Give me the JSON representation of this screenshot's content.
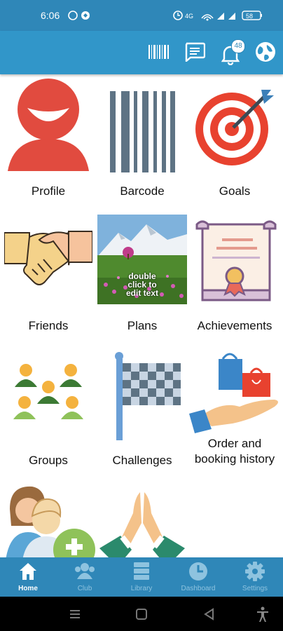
{
  "status": {
    "time": "6:06",
    "battery": "58"
  },
  "appbar": {
    "notification_count": "48"
  },
  "tiles": [
    {
      "label": "Profile"
    },
    {
      "label": "Barcode"
    },
    {
      "label": "Goals"
    },
    {
      "label": "Friends"
    },
    {
      "label": "Plans",
      "overlay": "double\nclick to\nedit text"
    },
    {
      "label": "Achievements"
    },
    {
      "label": "Groups"
    },
    {
      "label": "Challenges"
    },
    {
      "label": "Order and booking history"
    }
  ],
  "bottom_nav": [
    {
      "label": "Home",
      "icon": "home-icon"
    },
    {
      "label": "Club",
      "icon": "club-icon"
    },
    {
      "label": "Library",
      "icon": "library-icon"
    },
    {
      "label": "Dashboard",
      "icon": "dashboard-icon"
    },
    {
      "label": "Settings",
      "icon": "settings-icon"
    }
  ],
  "colors": {
    "primary": "#3196c9",
    "nav_active": "#ffffff",
    "nav_inactive": "#8ec3df"
  }
}
